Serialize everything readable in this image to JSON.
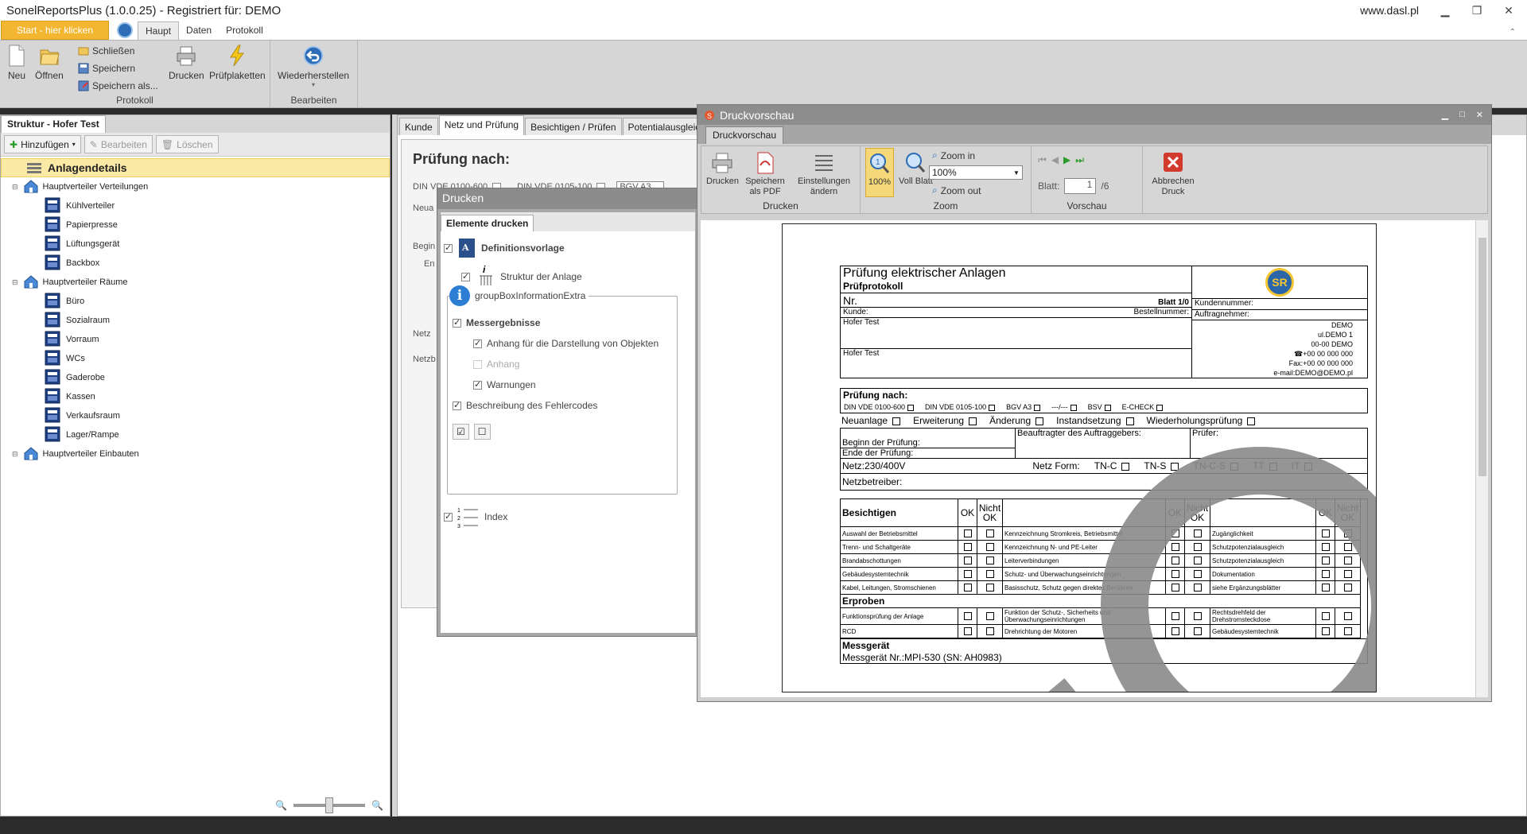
{
  "app": {
    "title": "SonelReportsPlus (1.0.0.25) - Registriert für: DEMO",
    "website": "www.dasl.pl"
  },
  "ribbon": {
    "start_button": "Start - hier klicken",
    "tabs": [
      "Haupt",
      "Daten",
      "Protokoll"
    ],
    "groups": {
      "protokoll": {
        "label": "Protokoll",
        "neu": "Neu",
        "oeffnen": "Öffnen",
        "schliessen": "Schließen",
        "speichern": "Speichern",
        "speichern_als": "Speichern als...",
        "drucken": "Drucken",
        "pruefplaketten": "Prüfplaketten"
      },
      "bearbeiten": {
        "label": "Bearbeiten",
        "wiederherstellen": "Wiederherstellen"
      }
    }
  },
  "left_panel": {
    "tab": "Struktur - Hofer Test",
    "toolbar": {
      "hinzufuegen": "Hinzufügen",
      "bearbeiten": "Bearbeiten",
      "loeschen": "Löschen"
    },
    "tree": {
      "root": "Anlagendetails",
      "groups": [
        {
          "label": "Hauptverteiler Verteilungen",
          "children": [
            "Kühlverteiler",
            "Papierpresse",
            "Lüftungsgerät",
            "Backbox"
          ]
        },
        {
          "label": "Hauptverteiler Räume",
          "children": [
            "Büro",
            "Sozialraum",
            "Vorraum",
            "WCs",
            "Gaderobe",
            "Kassen",
            "Verkaufsraum",
            "Lager/Rampe"
          ]
        },
        {
          "label": "Hauptverteiler Einbauten",
          "children": []
        }
      ]
    }
  },
  "main": {
    "tabs": [
      "Kunde",
      "Netz und Prüfung",
      "Besichtigen / Prüfen",
      "Potentialausgleic"
    ],
    "form": {
      "heading": "Prüfung nach:",
      "din1": "DIN VDE 0100-600",
      "din2": "DIN VDE 0105-100",
      "bgv": "BGV A3",
      "neua": "Neua",
      "begin": "Begin",
      "en": "En",
      "netz1": "Netz",
      "netz2": "Netzb"
    }
  },
  "print_dialog": {
    "title": "Drucken",
    "tab": "Elemente drucken",
    "items": {
      "definitionsvorlage": "Definitionsvorlage",
      "struktur": "Struktur der Anlage",
      "groupbox": "groupBoxInformationExtra",
      "messergebnisse": "Messergebnisse",
      "anhang_darstellung": "Anhang für  die Darstellung von Objekten",
      "anhang": "Anhang",
      "warnungen": "Warnungen",
      "beschreibung": "Beschreibung des Fehlercodes",
      "index": "Index"
    }
  },
  "preview": {
    "title": "Druckvorschau",
    "tab": "Druckvorschau",
    "groups": {
      "drucken": {
        "label": "Drucken",
        "drucken": "Drucken",
        "pdf": "Speichern als PDF",
        "einstellungen": "Einstellungen ändern"
      },
      "zoom": {
        "label": "Zoom",
        "z100": "100%",
        "vollblatt": "Voll Blatt",
        "zoom_in": "Zoom in",
        "zoom_out": "Zoom out",
        "value": "100%"
      },
      "vorschau": {
        "label": "Vorschau",
        "blatt_label": "Blatt:",
        "blatt_value": "1",
        "blatt_total": "/6"
      },
      "abbrechen": "Abbrechen Druck"
    },
    "doc": {
      "title": "Prüfung elektrischer Anlagen",
      "subtitle": "Prüfprotokoll",
      "nr": "Nr.",
      "blatt": "Blatt 1/0",
      "kundennummer": "Kundennummer:",
      "kunde": "Kunde:",
      "bestellnummer": "Bestellnummer:",
      "auftragnehmer": "Auftragnehmer:",
      "kunde_name": "Hofer Test",
      "kunde_name2": "Hofer Test",
      "contractor": [
        "DEMO",
        "ul.DEMO 1",
        "00-00 DEMO",
        "☎+00 00 000 000",
        "Fax:+00 00 000 000",
        "e-mail:DEMO@DEMO.pl"
      ],
      "logo": "SR",
      "pruefung_nach": "Prüfung nach:",
      "standards": [
        "DIN VDE 0100-600",
        "DIN VDE 0105-100",
        "BGV A3",
        "---/---",
        "BSV",
        "E-CHECK"
      ],
      "types": [
        "Neuanlage",
        "Erweiterung",
        "Änderung",
        "Instandsetzung",
        "Wiederholungsprüfung"
      ],
      "beginn": "Beginn der Prüfung:",
      "ende": "Ende der Prüfung:",
      "beauftragter": "Beauftragter des Auftraggebers:",
      "pruefer": "Prüfer:",
      "netz": "Netz:230/400V",
      "netzform": "Netz Form:",
      "netzformen": [
        "TN-C",
        "TN-S",
        "TN-C-S",
        "TT",
        "IT"
      ],
      "netzbetreiber": "Netzbetreiber:",
      "besichtigen": "Besichtigen",
      "ok": "OK",
      "nicht_ok": "Nicht OK",
      "rows": [
        [
          "Auswahl der Betriebsmittel",
          "Kennzeichnung Stromkreis, Betriebsmittel",
          "Zugänglichkeit"
        ],
        [
          "Trenn- und Schaltgeräte",
          "Kennzeichnung N- und PE-Leiter",
          "Schutzpotenzialausgleich"
        ],
        [
          "Brandabschottungen",
          "Leiterverbindungen",
          "Schutzpotenzialausgleich"
        ],
        [
          "Gebäudesystemtechnik",
          "Schutz- und Überwachungseinrichtungen",
          "Dokumentation"
        ],
        [
          "Kabel, Leitungen, Stromschienen",
          "Basisschutz, Schutz gegen direktes Berühren",
          "siehe Ergänzungsblätter"
        ]
      ],
      "erproben": "Erproben",
      "erproben_rows": [
        [
          "Funktionsprüfung der Anlage",
          "Funktion der Schutz-, Sicherheits und Überwachungseinrichtungen",
          "Rechtsdrehfeld der Drehstromsteckdose"
        ],
        [
          "RCD",
          "Drehrichtung der Motoren",
          "Gebäudesystemtechnik"
        ]
      ],
      "messgeraet": "Messgerät",
      "messgeraet_nr": "Messgerät Nr.:MPI-530 (SN: AH0983)"
    }
  },
  "colors": {
    "start": "#f2b630",
    "ribbon": "#d6d6d6",
    "accent": "#2c6db6"
  }
}
